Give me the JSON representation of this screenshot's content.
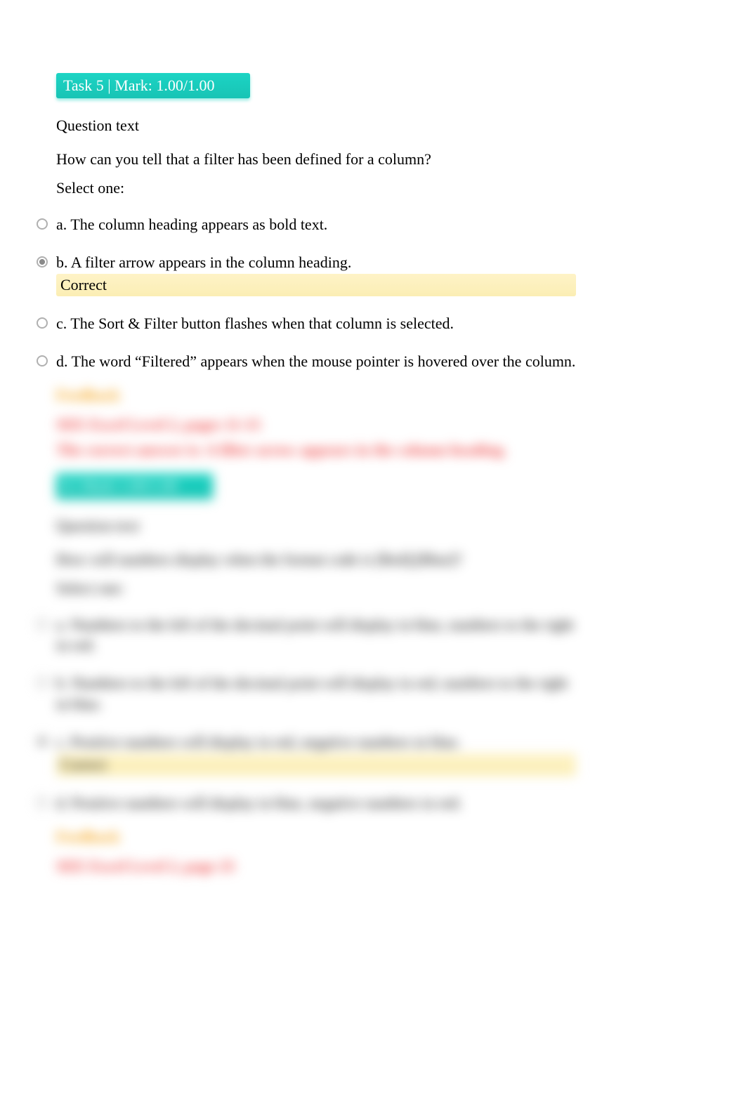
{
  "task5": {
    "header": "Task 5 | Mark: 1.00/1.00",
    "question_heading": "Question text",
    "question_body": "How can you tell that a filter has been defined for a column?",
    "select_one": "Select one:",
    "options": {
      "a": "a. The column heading appears as bold text.",
      "b": "b. A filter arrow appears in the column heading.",
      "c": "c. The Sort & Filter button flashes when that column is selected.",
      "d": "d. The word “Filtered” appears when the mouse pointer is hovered over the column."
    },
    "correct_label": "Correct",
    "feedback_heading": "Feedback",
    "feedback_ref": "SEE Excel Level 2, pages 11-15",
    "feedback_correct": "The correct answer is: A filter arrow appears in the column heading."
  },
  "task6": {
    "header": "6 | Mark 1.00/1.00",
    "question_heading": "Question text",
    "question_body": "How will numbers display when the format code is [Red];[Blue]?",
    "select_one": "Select one:",
    "options": {
      "a": "a. Numbers to the left of the decimal point will display in blue, numbers to the right in red.",
      "b": "b. Numbers to the left of the decimal point will display in red, numbers to the right in blue.",
      "c": "c. Positive numbers will display in red, negative numbers in blue.",
      "d": "d. Positive numbers will display in blue, negative numbers in red."
    },
    "correct_label": "Correct",
    "feedback_heading": "Feedback",
    "feedback_ref": "SEE Excel Level 2, page 25"
  }
}
